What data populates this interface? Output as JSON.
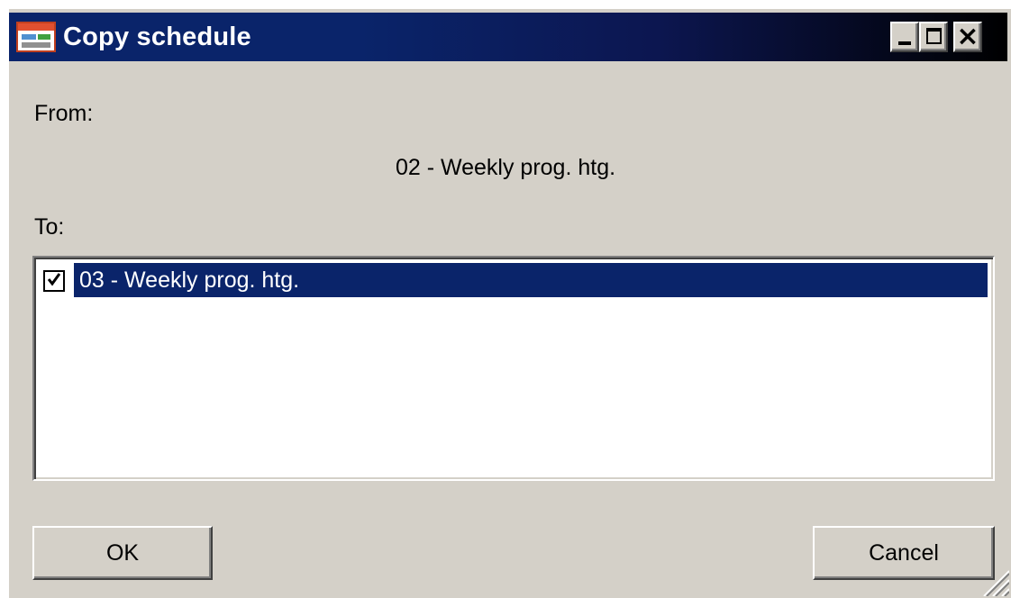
{
  "window": {
    "title": "Copy schedule",
    "icon": "app-schedule-icon"
  },
  "titlebar_buttons": {
    "minimize": "minimize-icon",
    "maximize": "maximize-icon",
    "close": "close-icon"
  },
  "from": {
    "label": "From:",
    "value": "02 - Weekly prog. htg."
  },
  "to": {
    "label": "To:",
    "items": [
      {
        "label": "03 - Weekly prog. htg.",
        "checked": true,
        "selected": true
      }
    ]
  },
  "buttons": {
    "ok": "OK",
    "cancel": "Cancel"
  },
  "colors": {
    "titlebar": "#0a246a",
    "selection": "#0a246a",
    "face": "#d4d0c8"
  }
}
